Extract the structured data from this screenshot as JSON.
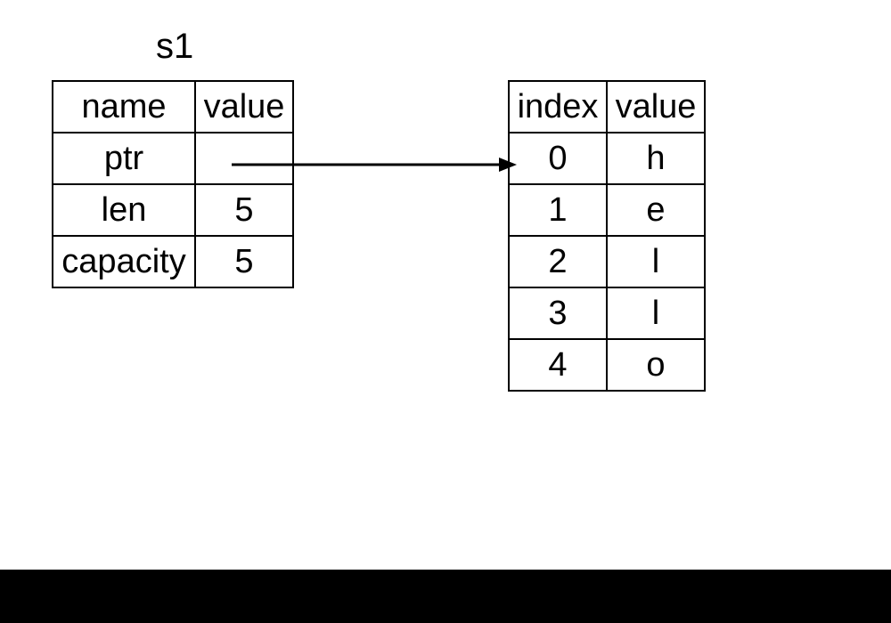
{
  "title": "s1",
  "left_table": {
    "header": {
      "c0": "name",
      "c1": "value"
    },
    "rows": [
      {
        "c0": "ptr",
        "c1": ""
      },
      {
        "c0": "len",
        "c1": "5"
      },
      {
        "c0": "capacity",
        "c1": "5"
      }
    ]
  },
  "right_table": {
    "header": {
      "c0": "index",
      "c1": "value"
    },
    "rows": [
      {
        "c0": "0",
        "c1": "h"
      },
      {
        "c0": "1",
        "c1": "e"
      },
      {
        "c0": "2",
        "c1": "l"
      },
      {
        "c0": "3",
        "c1": "l"
      },
      {
        "c0": "4",
        "c1": "o"
      }
    ]
  }
}
